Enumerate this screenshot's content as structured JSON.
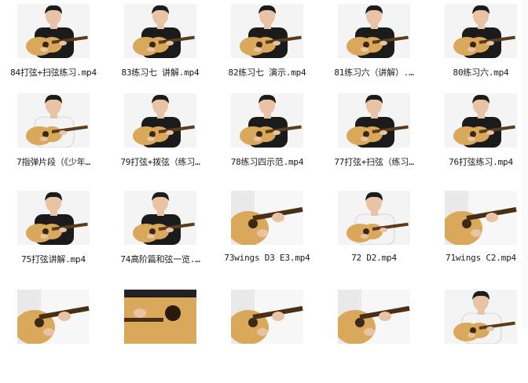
{
  "files": [
    {
      "name": "84打弦+扫弦练习.mp4",
      "scene": "guitar-black-shirt"
    },
    {
      "name": "83练习七 讲解.mp4",
      "scene": "guitar-black-shirt"
    },
    {
      "name": "82练习七 演示.mp4",
      "scene": "guitar-black-shirt"
    },
    {
      "name": "81练习六（讲解）.…",
      "scene": "guitar-black-shirt"
    },
    {
      "name": "80练习六.mp4",
      "scene": "guitar-black-shirt"
    },
    {
      "name": "7指弹片段（《少年…",
      "scene": "guitar-white-shirt"
    },
    {
      "name": "79打弦+拨弦（练习…",
      "scene": "guitar-black-shirt"
    },
    {
      "name": "78练习四示范.mp4",
      "scene": "guitar-black-shirt"
    },
    {
      "name": "77打弦+扫弦（练习…",
      "scene": "guitar-black-shirt"
    },
    {
      "name": "76打弦练习.mp4",
      "scene": "guitar-black-shirt"
    },
    {
      "name": "75打弦讲解.mp4",
      "scene": "guitar-black-shirt"
    },
    {
      "name": "74高阶篇和弦一览.…",
      "scene": "guitar-black-shirt"
    },
    {
      "name": "73wings D3 E3.mp4",
      "scene": "closeup-white"
    },
    {
      "name": "72 D2.mp4",
      "scene": "guitar-white-shirt"
    },
    {
      "name": "71wings C2.mp4",
      "scene": "closeup-white"
    },
    {
      "name": "",
      "scene": "closeup-white"
    },
    {
      "name": "",
      "scene": "closeup-dark"
    },
    {
      "name": "",
      "scene": "closeup-white"
    },
    {
      "name": "",
      "scene": "closeup-white"
    },
    {
      "name": "",
      "scene": "guitar-white-shirt"
    }
  ],
  "colors": {
    "background": "#ffffff",
    "label": "#1a1a1a",
    "guitar_body": "#d9a85a",
    "shirt_black": "#1b1b1b",
    "shirt_white": "#f3f3f3",
    "skin": "#e8c3a5",
    "hair": "#1c1c1c",
    "wall": "#f4f4f4"
  }
}
